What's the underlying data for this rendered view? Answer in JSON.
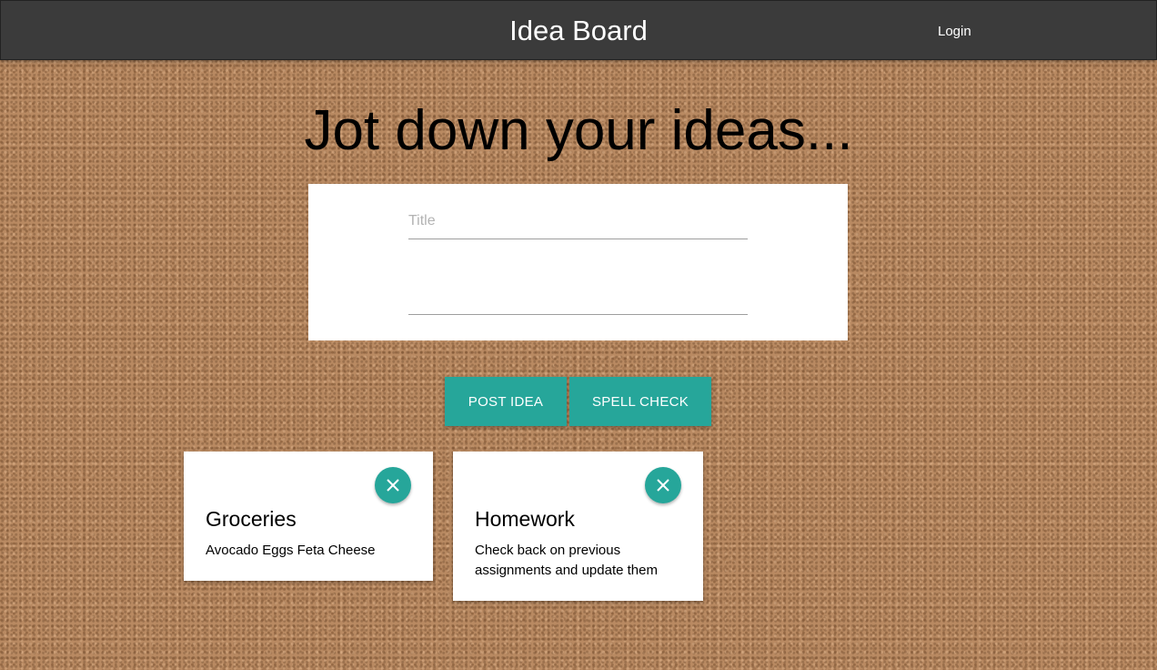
{
  "header": {
    "title": "Idea Board",
    "login_label": "Login"
  },
  "main": {
    "heading": "Jot down your ideas...",
    "form": {
      "title_placeholder": "Title",
      "title_value": "",
      "body_value": ""
    },
    "buttons": {
      "post_label": "POST IDEA",
      "spell_label": "SPELL CHECK"
    }
  },
  "ideas": [
    {
      "title": "Groceries",
      "body": "Avocado Eggs Feta Cheese"
    },
    {
      "title": "Homework",
      "body": "Check back on previous assignments and update them"
    }
  ],
  "icons": {
    "close": "close-icon"
  },
  "colors": {
    "navbar": "#3b3b3b",
    "accent": "#26a69a",
    "card": "#ffffff",
    "cork": "#b98a62"
  }
}
